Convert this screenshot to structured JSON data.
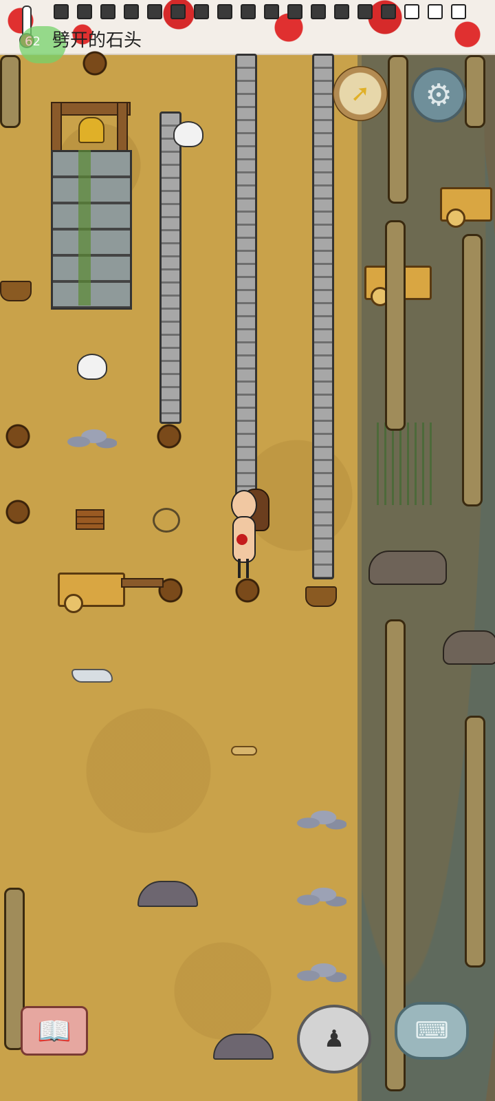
{
  "hud": {
    "status_text": "劈开的石头",
    "age": "62"
  },
  "food_meter": {
    "filled": 15,
    "total": 18
  },
  "icons": {
    "compass": "compass-icon",
    "settings": "gear-icon",
    "book": "book-icon",
    "emote": "emote-icon",
    "keyboard": "keyboard-icon",
    "thermometer": "thermometer-icon"
  },
  "colors": {
    "ground": "#c9a24a",
    "swamp": "#6b6448",
    "blood": "#e03030",
    "age_badge": "#76d36b",
    "settings_button": "#6f8f9a"
  }
}
